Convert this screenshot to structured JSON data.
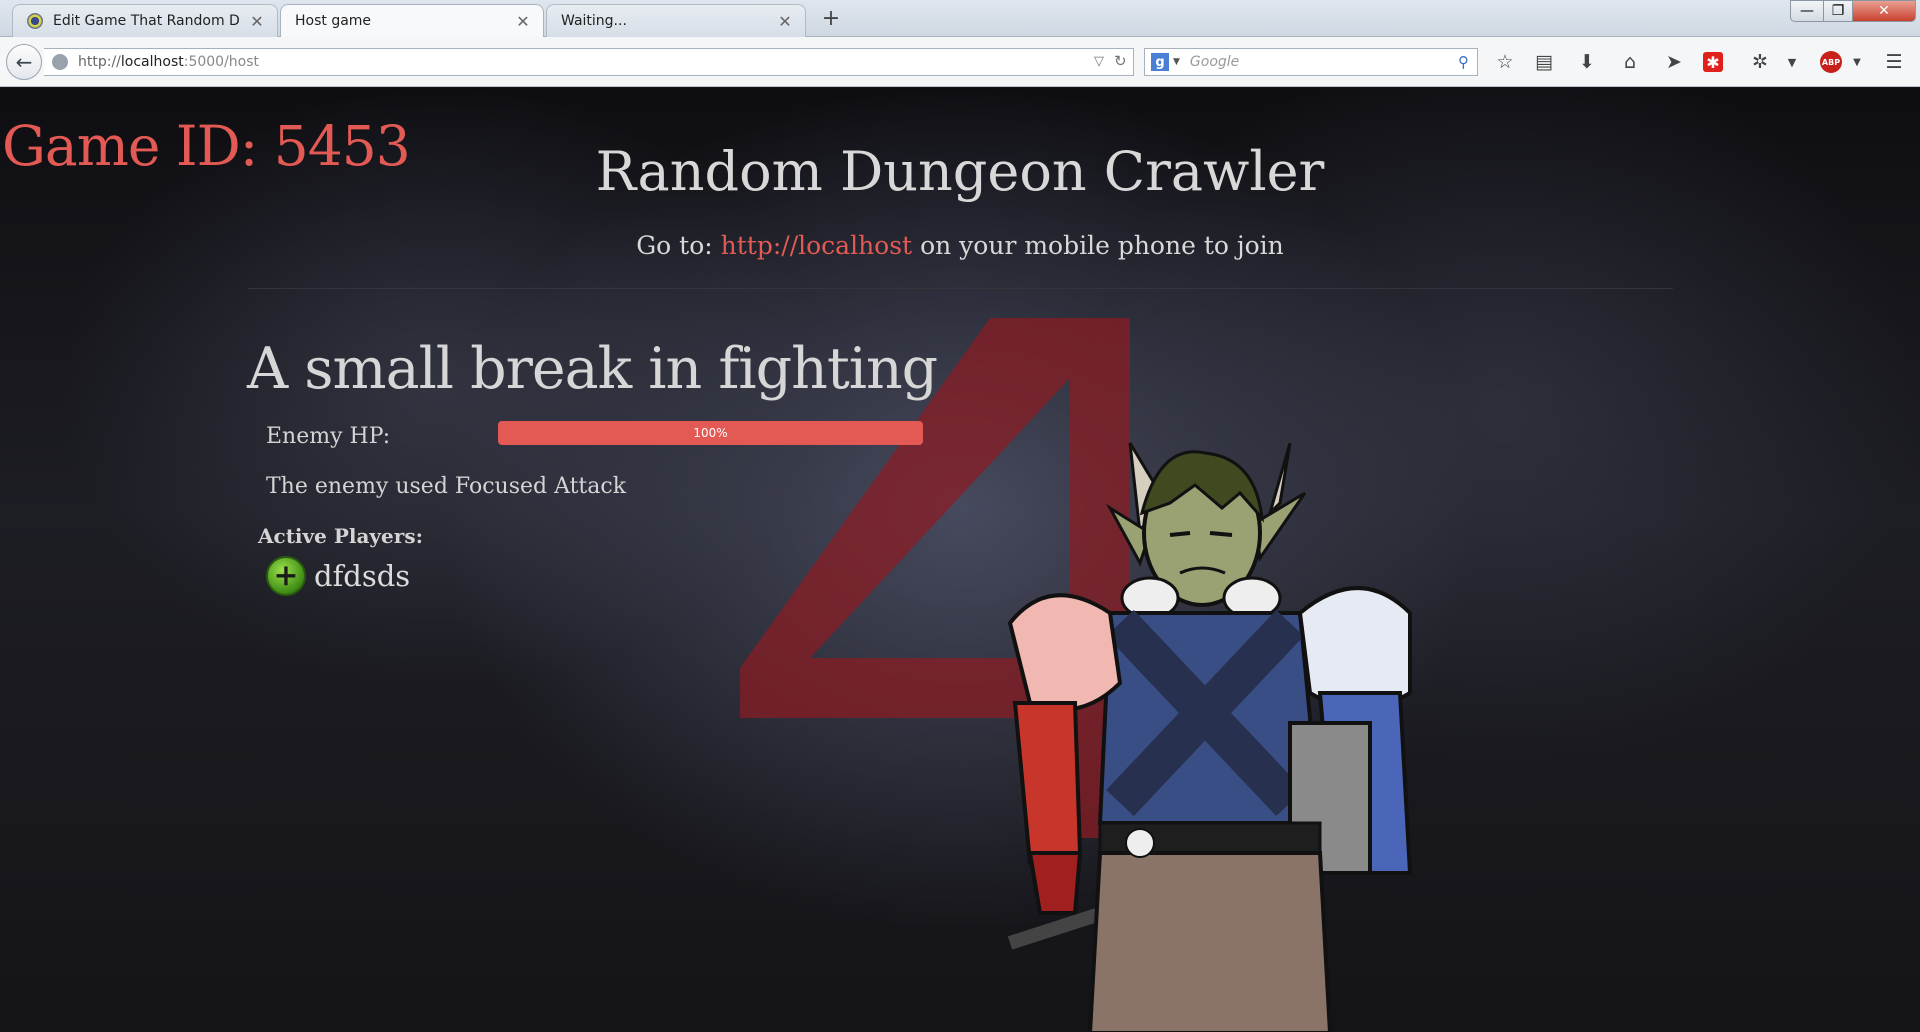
{
  "browser": {
    "tabs": [
      {
        "label": "Edit Game That Random D...",
        "active": false
      },
      {
        "label": "Host game",
        "active": true
      },
      {
        "label": "Waiting...",
        "active": false
      }
    ],
    "url": {
      "prefix": "http://",
      "host": "localhost",
      "tail": ":5000/host"
    },
    "search": {
      "placeholder": "Google",
      "engine_icon": "g-icon"
    },
    "toolbar_icons": [
      "star-icon",
      "reading-list-icon",
      "download-icon",
      "home-icon",
      "send-icon",
      "red-square-icon",
      "bug-icon",
      "chevron-down-icon",
      "adblock-icon",
      "menu-icon"
    ],
    "abp_label": "ABP"
  },
  "page": {
    "game_id_label": "Game ID:",
    "game_id": "5453",
    "title": "Random Dungeon Crawler",
    "join_prefix": "Go to:",
    "join_link": "http://localhost",
    "join_suffix": "on your mobile phone to join",
    "headline": "A small break in fighting",
    "enemy_hp_label": "Enemy HP:",
    "enemy_hp_text": "100%",
    "enemy_hp_fraction": 1.0,
    "enemy_action": "The enemy used Focused Attack",
    "active_players_label": "Active Players:",
    "players": [
      {
        "name": "dfdsds",
        "icon": "plus-icon"
      }
    ],
    "countdown": "4",
    "colors": {
      "accent": "#e35a55",
      "text": "#d8d8d8",
      "countdown": "#8c1c22"
    }
  }
}
